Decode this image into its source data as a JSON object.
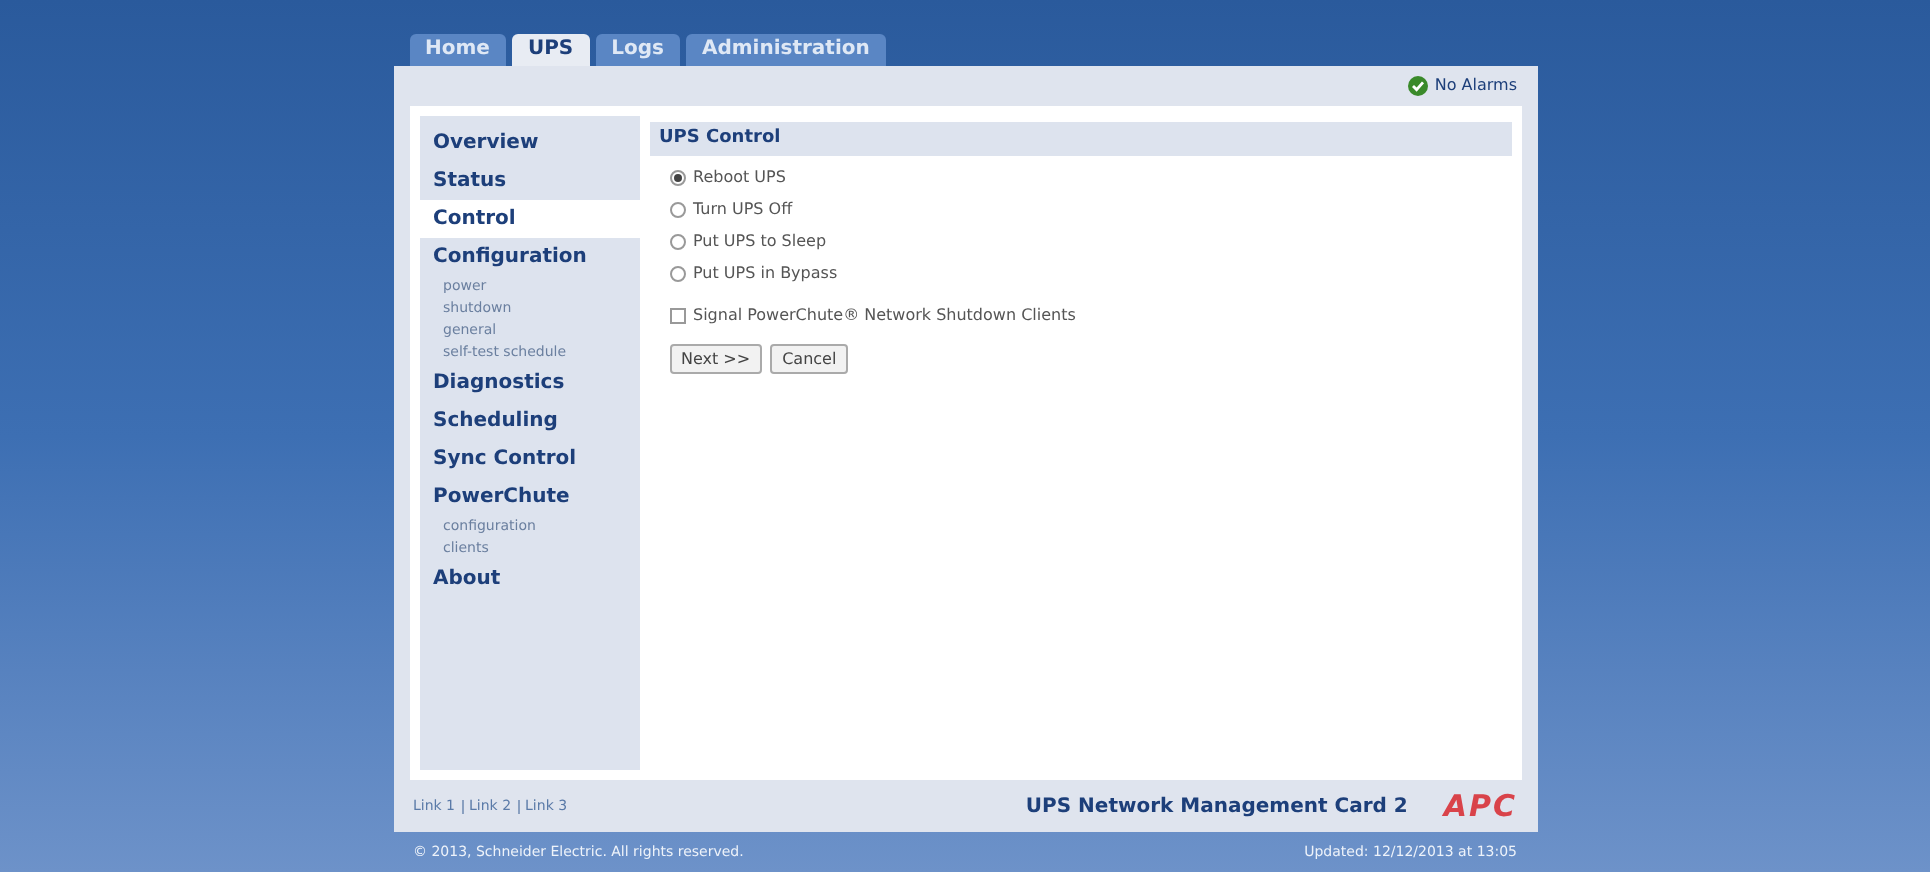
{
  "tabs": [
    {
      "label": "Home",
      "selected": false
    },
    {
      "label": "UPS",
      "selected": true
    },
    {
      "label": "Logs",
      "selected": false
    },
    {
      "label": "Administration",
      "selected": false
    }
  ],
  "alarm_status": "No Alarms",
  "sidebar": {
    "items": [
      {
        "label": "Overview",
        "selected": false
      },
      {
        "label": "Status",
        "selected": false
      },
      {
        "label": "Control",
        "selected": true
      },
      {
        "label": "Configuration",
        "selected": false,
        "children": [
          {
            "label": "power"
          },
          {
            "label": "shutdown"
          },
          {
            "label": "general"
          },
          {
            "label": "self-test schedule"
          }
        ]
      },
      {
        "label": "Diagnostics",
        "selected": false
      },
      {
        "label": "Scheduling",
        "selected": false
      },
      {
        "label": "Sync Control",
        "selected": false
      },
      {
        "label": "PowerChute",
        "selected": false,
        "children": [
          {
            "label": "configuration"
          },
          {
            "label": "clients"
          }
        ]
      },
      {
        "label": "About",
        "selected": false
      }
    ]
  },
  "content": {
    "title": "UPS Control",
    "options": [
      {
        "label": "Reboot UPS",
        "selected": true
      },
      {
        "label": "Turn UPS Off",
        "selected": false
      },
      {
        "label": "Put UPS to Sleep",
        "selected": false
      },
      {
        "label": "Put UPS in Bypass",
        "selected": false
      }
    ],
    "checkbox": {
      "label": "Signal PowerChute® Network Shutdown Clients",
      "checked": false
    },
    "buttons": [
      "Next >>",
      "Cancel"
    ]
  },
  "footer": {
    "links": [
      "Link 1",
      "Link 2",
      "Link 3"
    ],
    "product": "UPS Network Management Card 2",
    "logo": "APC"
  },
  "copyright": "© 2013, Schneider Electric. All rights reserved.",
  "updated": "Updated: 12/12/2013 at 13:05"
}
